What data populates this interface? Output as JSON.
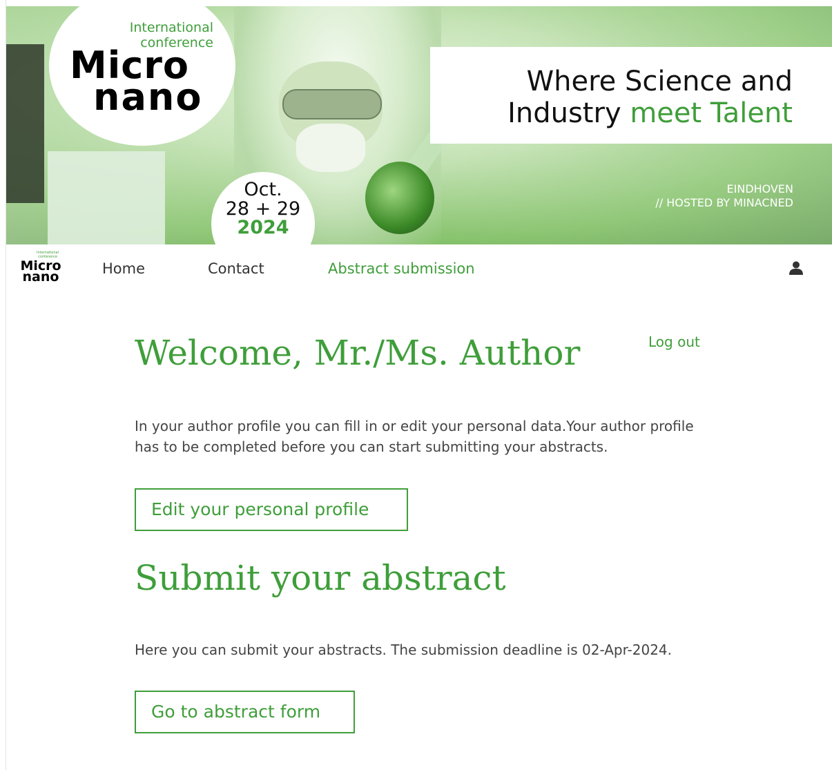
{
  "banner": {
    "logo_intl": "International",
    "logo_conf": "conference",
    "logo_micro": "Micro",
    "logo_nano": "nano",
    "date_month": "Oct.",
    "date_days": "28 + 29",
    "date_year": "2024",
    "tagline_line1": "Where Science and",
    "tagline_line2_prefix": "Industry",
    "tagline_line2_accent": "meet Talent",
    "city": "EINDHOVEN",
    "hosted_by": "// HOSTED BY MINACNED"
  },
  "nav": {
    "logo_tiny": "International conference",
    "logo_micro": "Micro",
    "logo_nano": "nano",
    "items": [
      {
        "label": "Home"
      },
      {
        "label": "Contact"
      },
      {
        "label": "Abstract submission"
      }
    ],
    "active_index": 2
  },
  "main": {
    "welcome_title": "Welcome, Mr./Ms. Author",
    "logout_label": "Log out",
    "profile_text": "In your author profile you can fill in or edit your personal data.Your author profile has to be completed before you can start submitting your abstracts.",
    "profile_button": "Edit your personal profile",
    "submit_title": "Submit your abstract",
    "submit_text": "Here you can submit your abstracts. The submission deadline is 02-Apr-2024.",
    "submit_button": "Go to abstract form"
  },
  "colors": {
    "accent": "#3f9e3a",
    "text": "#444444"
  },
  "icons": {
    "user": "user-icon"
  }
}
